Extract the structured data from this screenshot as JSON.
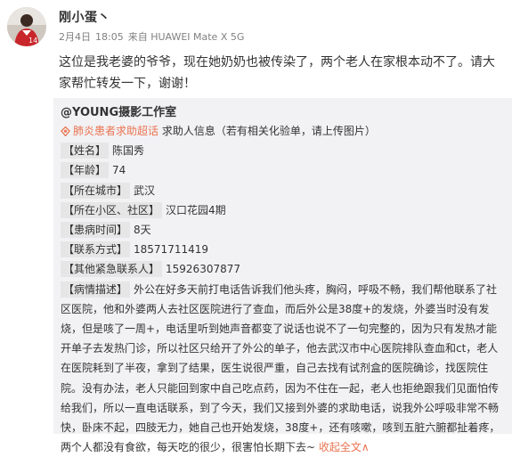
{
  "user": {
    "name": "刚小蛋丶"
  },
  "meta": {
    "date": "2月4日",
    "time": "18:05",
    "source": "来自 HUAWEI Mate X 5G"
  },
  "post": {
    "text": "这位是我老婆的爷爷，现在她奶奶也被传染了，两个老人在家根本动不了。请大家帮忙转发一下，谢谢！"
  },
  "repost": {
    "user": "@YOUNG摄影工作室",
    "tag": "肺炎患者求助超话",
    "intro": "求助人信息（若有相关化验单，请上传图片）",
    "fields": [
      {
        "label": "【姓名】",
        "value": "陈国秀"
      },
      {
        "label": "【年龄】",
        "value": "74"
      },
      {
        "label": "【所在城市】",
        "value": "武汉"
      },
      {
        "label": "【所在小区、社区】",
        "value": "汉口花园4期"
      },
      {
        "label": "【患病时间】",
        "value": "8天"
      },
      {
        "label": "【联系方式】",
        "value": "18571711419"
      },
      {
        "label": "【其他紧急联系人】",
        "value": "15926307877"
      }
    ],
    "desc_label": "【病情描述】",
    "desc": "外公在好多天前打电话告诉我们他头疼，胸闷，呼吸不畅，我们帮他联系了社区医院，他和外婆两人去社区医院进行了查血，而后外公是38度+的发烧，外婆当时没有发烧，但是咳了一周+，电话里听到她声音都变了说话也说不了一句完整的，因为只有发热才能开单子去发热门诊，所以社区只给开了外公的单子，他去武汉市中心医院排队查血和ct，老人在医院耗到了半夜，拿到了结果，医生说很严重，自己去找有试剂盒的医院确诊，找医院住院。没有办法，老人只能回到家中自己吃点药，因为不住在一起，老人也拒绝跟我们见面怕传给我们，所以一直电话联系，到了今天，我们又接到外婆的求助电话，说我外公呼吸非常不畅快，卧床不起，四肢无力，她自己也开始发烧，38度+，还有咳嗽，咳到五脏六腑都扯着疼，两个人都没有食欲，每天吃的很少，很害怕长期下去~",
    "more": "收起全文",
    "more_arrow": "∧"
  }
}
